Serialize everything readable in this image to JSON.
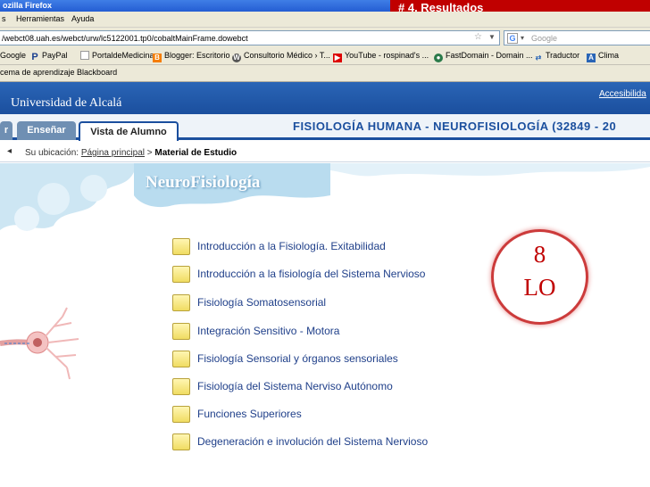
{
  "browser": {
    "title": "ozilla Firefox",
    "menu": [
      "s",
      "Herramientas",
      "Ayuda"
    ],
    "url": "/webct08.uah.es/webct/urw/lc5122001.tp0/cobaltMainFrame.dowebct",
    "search_placeholder": "Google",
    "bookmarks": [
      "Google",
      "PayPal",
      "PortaldeMedicina",
      "Blogger: Escritorio",
      "Consultorio Médico › T...",
      "YouTube - rospinad's ...",
      "FastDomain - Domain ...",
      "Traductor",
      "Clima"
    ],
    "bookmark_row2": "cema de aprendizaje Blackboard"
  },
  "slide_label": "# 4. Resultados",
  "site": {
    "university": "Universidad de Alcalá",
    "accessibility": "Accesibilida",
    "tabs": [
      "r",
      "Enseñar",
      "Vista de Alumno"
    ],
    "course_title": "FISIOLOGÍA HUMANA - NEUROFISIOLOGÍA (32849 - 20"
  },
  "breadcrumb": {
    "prefix": "Su ubicación:",
    "home": "Página principal",
    "separator": " > ",
    "current": "Material de Estudio"
  },
  "page_heading": "NeuroFisiología",
  "modules": [
    "Introducción a la Fisiología. Exitabilidad",
    "Introducción a la fisiología del Sistema Nervioso",
    "Fisiología Somatosensorial",
    "Integración Sensitivo - Motora",
    "Fisiología Sensorial y órganos sensoriales",
    "Fisiología del Sistema Nerviso Autónomo",
    "Funciones Superiores",
    "Degeneración e involución del Sistema Nervioso"
  ],
  "badge": {
    "number": "8",
    "label": "LO"
  },
  "colors": {
    "accent_blue": "#1b4f9e",
    "badge_red": "#c00000",
    "link_blue": "#20408a"
  }
}
